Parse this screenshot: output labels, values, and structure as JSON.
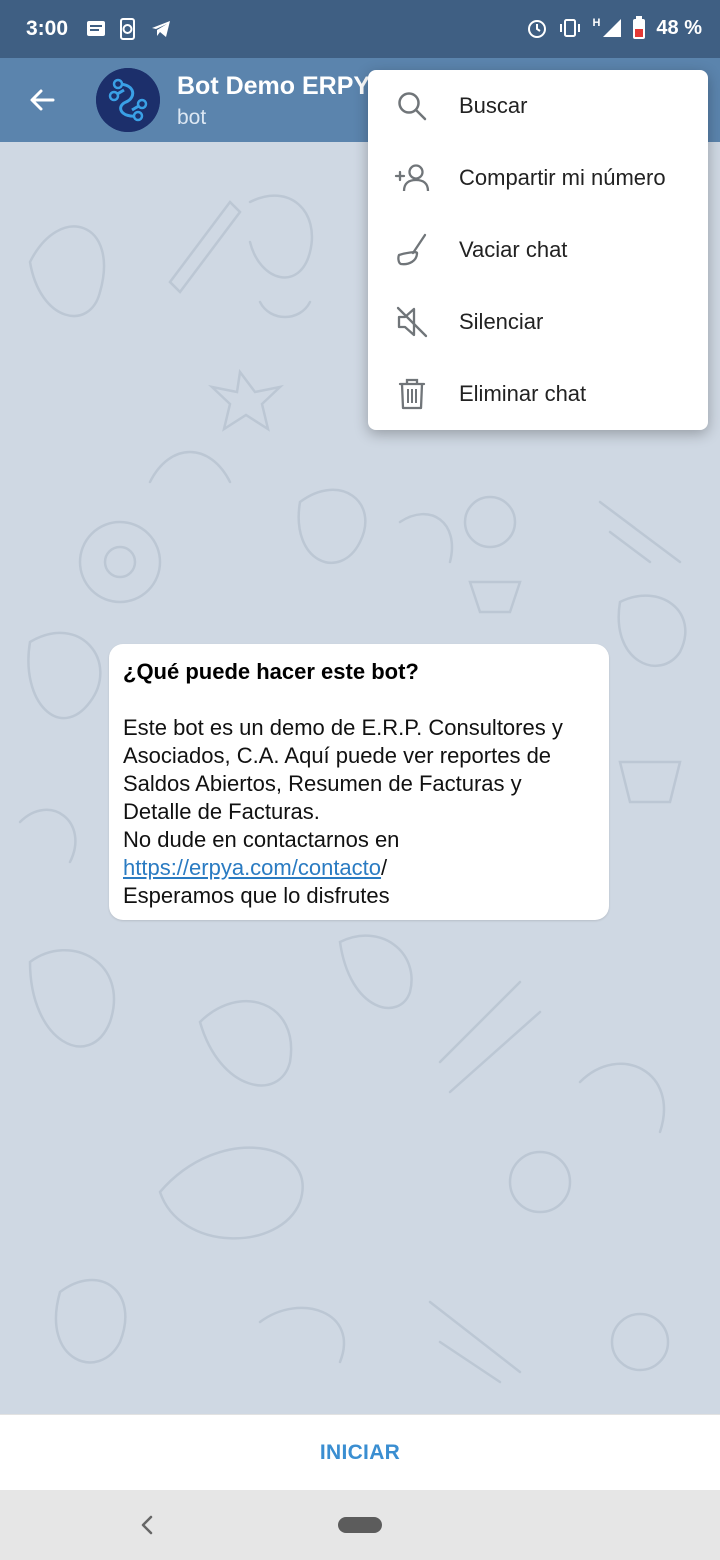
{
  "status_bar": {
    "time": "3:00",
    "battery": "48 %",
    "network": "H"
  },
  "header": {
    "title": "Bot Demo ERPYA",
    "subtitle": "bot"
  },
  "menu": {
    "items": [
      {
        "label": "Buscar",
        "icon": "search-icon"
      },
      {
        "label": "Compartir mi número",
        "icon": "add-contact-icon"
      },
      {
        "label": "Vaciar chat",
        "icon": "broom-icon"
      },
      {
        "label": "Silenciar",
        "icon": "mute-icon"
      },
      {
        "label": "Eliminar chat",
        "icon": "trash-icon"
      }
    ]
  },
  "bot_info": {
    "title": "¿Qué puede hacer este bot?",
    "description": "Este bot es un demo de E.R.P. Consultores y Asociados, C.A. Aquí puede ver reportes de Saldos Abiertos, Resumen de Facturas y Detalle de Facturas.",
    "contact_prefix": "No dude en contactarnos en",
    "link_text": "https://erpya.com/contacto",
    "link_suffix": "/",
    "closing": "Esperamos que lo disfrutes"
  },
  "bottom": {
    "start_label": "INICIAR"
  },
  "colors": {
    "status_bar": "#3f5f83",
    "app_bar": "#5b84ad",
    "chat_background": "#cfd8e3",
    "accent": "#3a8ed1",
    "link": "#2a7bc2"
  }
}
